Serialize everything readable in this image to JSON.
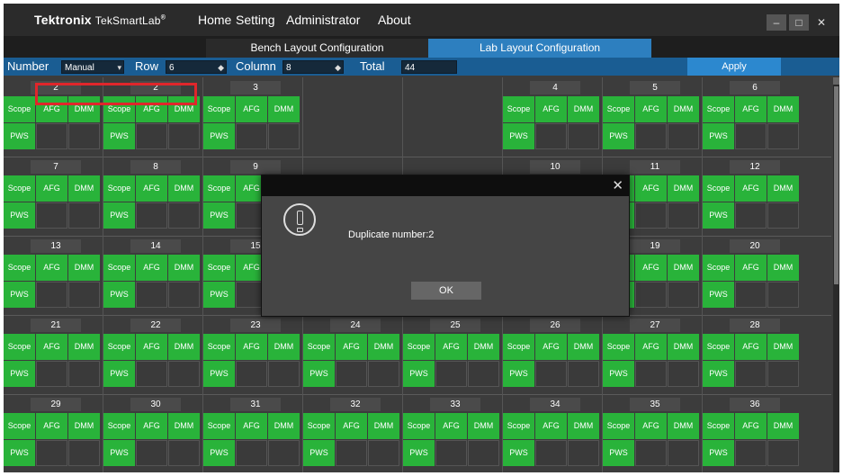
{
  "app": {
    "brand": "Tektronix",
    "product": "TekSmartLab",
    "menu": [
      "Home",
      "Setting",
      "Administrator",
      "About"
    ],
    "window_controls": [
      "–",
      "□",
      "✕"
    ]
  },
  "tabs": {
    "bench": "Bench Layout Configuration",
    "lab": "Lab Layout Configuration"
  },
  "controls": {
    "number_label": "Number",
    "number_value": "Manual",
    "row_label": "Row",
    "row_value": "6",
    "column_label": "Column",
    "column_value": "8",
    "total_label": "Total",
    "total_value": "44",
    "apply_label": "Apply"
  },
  "slot_labels": {
    "scope": "Scope",
    "afg": "AFG",
    "dmm": "DMM",
    "pws": "PWS"
  },
  "benches": [
    [
      "2",
      "2",
      "3",
      "",
      "",
      "4",
      "5",
      "6"
    ],
    [
      "7",
      "8",
      "9",
      "",
      "",
      "10",
      "11",
      "12"
    ],
    [
      "13",
      "14",
      "15",
      "",
      "",
      "",
      "19",
      "20"
    ],
    [
      "21",
      "22",
      "23",
      "24",
      "25",
      "26",
      "27",
      "28"
    ],
    [
      "29",
      "30",
      "31",
      "32",
      "33",
      "34",
      "35",
      "36"
    ]
  ],
  "dialog": {
    "message": "Duplicate number:2",
    "ok_label": "OK",
    "close_symbol": "✕"
  },
  "colors": {
    "slot_green": "#29b33a",
    "accent_blue": "#2d7fbf",
    "highlight_red": "#e0262b"
  }
}
